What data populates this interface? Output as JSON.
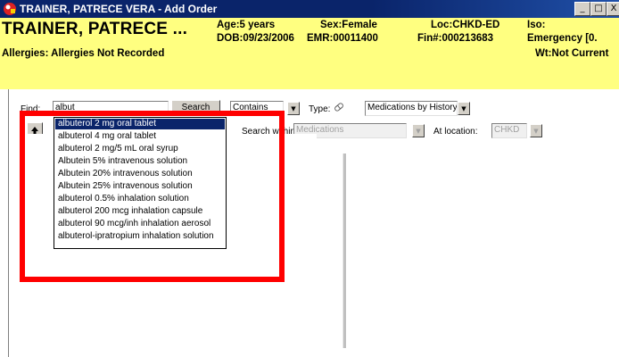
{
  "window": {
    "title": "TRAINER, PATRECE VERA - Add Order",
    "controls": [
      "_",
      "□",
      "X"
    ]
  },
  "banner": {
    "patient_name": "TRAINER, PATRECE ...",
    "age": "Age:5 years",
    "sex": "Sex:Female",
    "loc": "Loc:CHKD-ED",
    "iso": "Iso:",
    "dob": "DOB:09/23/2006",
    "emr": "EMR:00011400",
    "fin": "Fin#:000213683",
    "encounter": "Emergency [0.",
    "allergies": "Allergies: Allergies Not Recorded",
    "weight": "Wt:Not Current"
  },
  "search": {
    "find_label": "Find:",
    "find_value": "albut",
    "search_button": "Search",
    "match_mode": "Contains",
    "type_label": "Type:",
    "type_value": "Medications by History",
    "search_within_label": "Search within:",
    "search_within_value": "Medications",
    "at_location_label": "At location:",
    "at_location_value": "CHKD"
  },
  "suggestions": [
    "albuterol 2 mg oral tablet",
    "albuterol 4 mg oral tablet",
    "albuterol 2 mg/5 mL oral syrup",
    "Albutein 5% intravenous solution",
    "Albutein 20% intravenous solution",
    "Albutein 25% intravenous solution",
    "albuterol 0.5% inhalation solution",
    "albuterol 200 mcg inhalation capsule",
    "albuterol 90 mcg/inh inhalation aerosol",
    "albuterol-ipratropium inhalation solution"
  ],
  "selected_suggestion_index": 0,
  "colors": {
    "titlebar": "#0a246a",
    "banner": "#ffff80",
    "highlight": "#ff0000",
    "selection": "#0a246a"
  }
}
